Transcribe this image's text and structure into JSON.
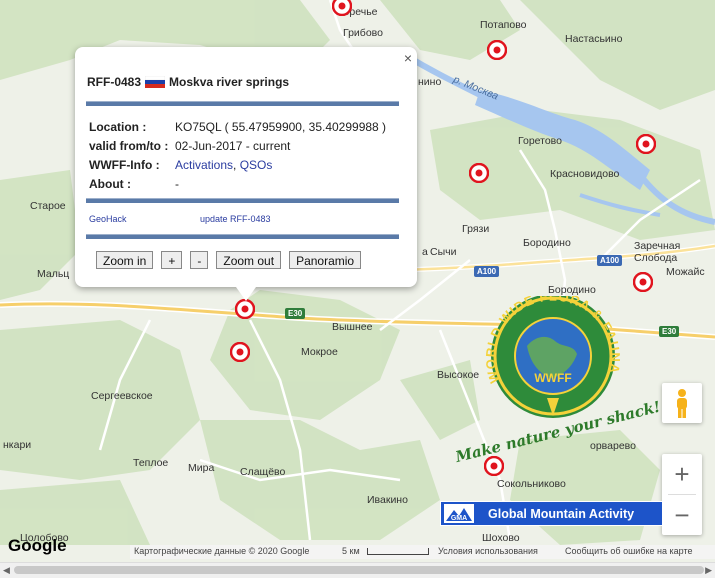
{
  "popup": {
    "close_label": "×",
    "title_id": "RFF-0483",
    "title_name": "Moskva river springs",
    "flag_icon": "russia-flag-icon",
    "rows": [
      {
        "key": "Location :",
        "value": "KO75QL ( 55.47959900, 35.40299988 )"
      },
      {
        "key": "valid from/to :",
        "value": "02-Jun-2017 - current"
      },
      {
        "key": "WWFF-Info :",
        "value_link1": "Activations",
        "value_sep": ",",
        "value_link2": "QSOs"
      },
      {
        "key": "About :",
        "value": "-"
      }
    ],
    "link_geohack": "GeoHack",
    "link_update": "update RFF-0483",
    "buttons": {
      "zoom_in": "Zoom in",
      "plus": "+",
      "minus": "-",
      "zoom_out": "Zoom out",
      "panoramio": "Panoramio"
    }
  },
  "places": [
    {
      "name": "Поречье"
    },
    {
      "name": "Грибово"
    },
    {
      "name": "Потапово"
    },
    {
      "name": "Настасьино"
    },
    {
      "name": "нино"
    },
    {
      "name": "р. Москва"
    },
    {
      "name": "Горетово"
    },
    {
      "name": "Красновидово"
    },
    {
      "name": "Старое"
    },
    {
      "name": "Грязи"
    },
    {
      "name": "Бородино"
    },
    {
      "name": "Заречная"
    },
    {
      "name": "Слобода"
    },
    {
      "name": "Мальц"
    },
    {
      "name": "Сычи"
    },
    {
      "name": "Бородино"
    },
    {
      "name": "Можайс"
    },
    {
      "name": "Вышнее"
    },
    {
      "name": "Мокрое"
    },
    {
      "name": "Высокое"
    },
    {
      "name": "Сергеевское"
    },
    {
      "name": "нкари"
    },
    {
      "name": "Теплое"
    },
    {
      "name": "Мира"
    },
    {
      "name": "Слащёво"
    },
    {
      "name": "Ивакино"
    },
    {
      "name": "Сокольниково"
    },
    {
      "name": "Шохово"
    },
    {
      "name": "Цолобово"
    },
    {
      "name": "орварево"
    },
    {
      "name": "а"
    }
  ],
  "roads": [
    "A100",
    "A100",
    "E30",
    "E30"
  ],
  "markers_count_note": "",
  "wwff_logo": {
    "ring_text": "WORLD WIDE FLORA & FAUNA",
    "center_text": "WWFF",
    "slogan": "Make nature your shack!"
  },
  "gma_banner": {
    "logo_text": "GMA",
    "label": "Global Mountain Activity"
  },
  "controls": {
    "zoom_in": "+",
    "zoom_out": "−",
    "pegman_icon": "pegman-icon"
  },
  "footer": {
    "google_logo": "Google",
    "map_data": "Картографические данные © 2020 Google",
    "scale": "5 км",
    "terms": "Условия использования",
    "report": "Сообщить об ошибке на карте"
  },
  "colors": {
    "marker_red": "#e0141e",
    "popup_bar": "#5a7aa8",
    "link": "#2a3ca0",
    "gma_blue": "#1d54c9",
    "forest": "#cfe2bf",
    "water": "#a6c6ef"
  }
}
